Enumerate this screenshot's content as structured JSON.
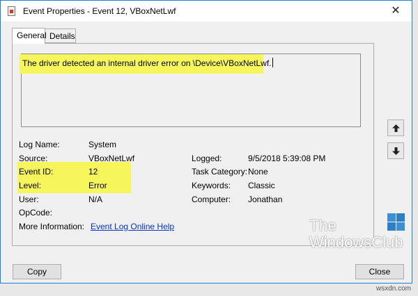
{
  "window": {
    "title": "Event Properties - Event 12, VBoxNetLwf",
    "close_glyph": "✕"
  },
  "tabs": [
    {
      "label": "General",
      "active": true
    },
    {
      "label": "Details",
      "active": false
    }
  ],
  "description": "The driver detected an internal driver error on \\Device\\VBoxNetLwf.",
  "fields_left": [
    {
      "label": "Log Name:",
      "value": "System"
    },
    {
      "label": "Source:",
      "value": "VBoxNetLwf"
    },
    {
      "label": "Event ID:",
      "value": "12"
    },
    {
      "label": "Level:",
      "value": "Error"
    },
    {
      "label": "User:",
      "value": "N/A"
    },
    {
      "label": "OpCode:",
      "value": ""
    },
    {
      "label": "More Information:",
      "value": "Event Log Online Help"
    }
  ],
  "fields_right": [
    {
      "label": "Logged:",
      "value": "9/5/2018 5:39:08 PM"
    },
    {
      "label": "Task Category:",
      "value": "None"
    },
    {
      "label": "Keywords:",
      "value": "Classic"
    },
    {
      "label": "Computer:",
      "value": "Jonathan"
    }
  ],
  "buttons": {
    "copy": "Copy",
    "close": "Close"
  },
  "logo": {
    "line1": "The",
    "line2": "WindowsClub"
  },
  "watermark": "wsxdn.com",
  "colors": {
    "highlight": "#f6f65c",
    "link": "#0033cc",
    "window_border": "#1e7fd6"
  },
  "icons": [
    "event-log-icon",
    "close-icon",
    "arrow-up-icon",
    "arrow-down-icon",
    "windows-logo-icon"
  ]
}
